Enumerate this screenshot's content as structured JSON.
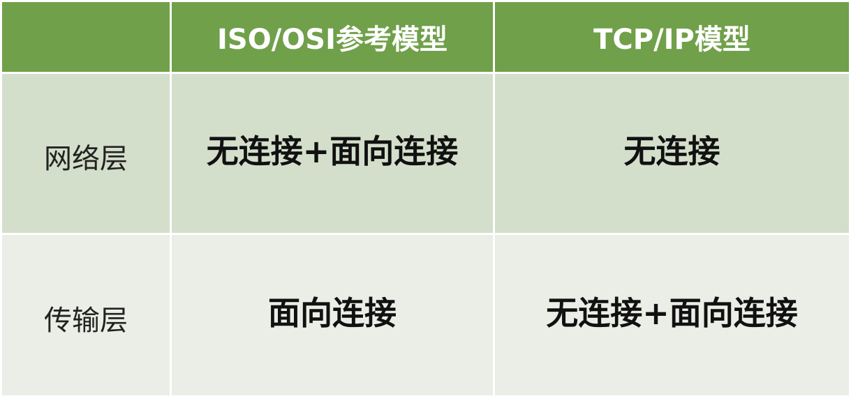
{
  "table": {
    "headers": [
      "",
      "ISO/OSI参考模型",
      "TCP/IP模型"
    ],
    "rows": [
      {
        "label": "网络层",
        "values": [
          "无连接+面向连接",
          "无连接"
        ]
      },
      {
        "label": "传输层",
        "values": [
          "面向连接",
          "无连接+面向连接"
        ]
      }
    ]
  },
  "colors": {
    "header_bg": "#70a04a",
    "header_text": "#ffffff",
    "row1_bg": "#d4dfcb",
    "row2_bg": "#eaeee6"
  }
}
